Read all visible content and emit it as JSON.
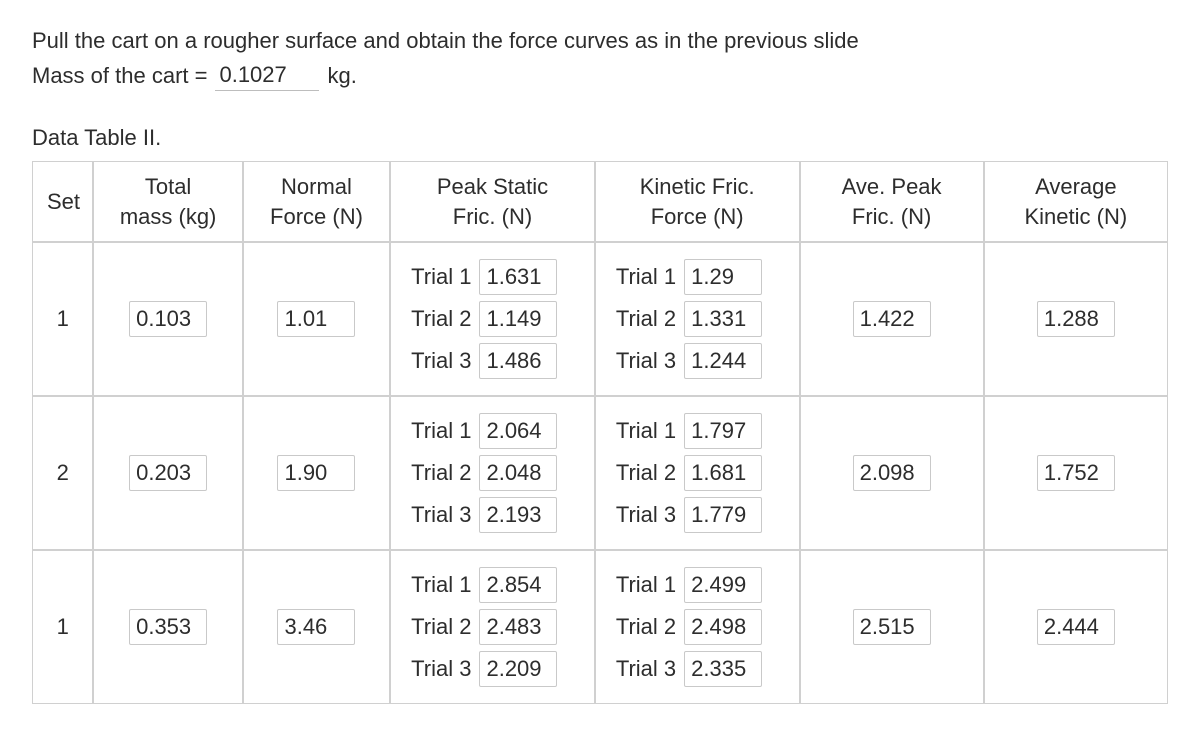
{
  "intro": "Pull the cart on a rougher surface and obtain the force curves as in the previous slide",
  "mass_prefix": "Mass of the cart =",
  "mass_value": "0.1027",
  "mass_unit": "kg.",
  "table_title": "Data Table II.",
  "headers": {
    "set": "Set",
    "total_mass_l1": "Total",
    "total_mass_l2": "mass (kg)",
    "normal_l1": "Normal",
    "normal_l2": "Force (N)",
    "peak_l1": "Peak Static",
    "peak_l2": "Fric. (N)",
    "kinetic_l1": "Kinetic Fric.",
    "kinetic_l2": "Force (N)",
    "ave_peak_l1": "Ave. Peak",
    "ave_peak_l2": "Fric. (N)",
    "ave_kin_l1": "Average",
    "ave_kin_l2": "Kinetic (N)"
  },
  "trial_labels": {
    "t1": "Trial 1",
    "t2": "Trial 2",
    "t3": "Trial 3"
  },
  "rows": [
    {
      "set": "1",
      "total_mass": "0.103",
      "normal_force": "1.01",
      "peak": {
        "t1": "1.631",
        "t2": "1.149",
        "t3": "1.486"
      },
      "kinetic": {
        "t1": "1.29",
        "t2": "1.331",
        "t3": "1.244"
      },
      "ave_peak": "1.422",
      "ave_kinetic": "1.288"
    },
    {
      "set": "2",
      "total_mass": "0.203",
      "normal_force": "1.90",
      "peak": {
        "t1": "2.064",
        "t2": "2.048",
        "t3": "2.193"
      },
      "kinetic": {
        "t1": "1.797",
        "t2": "1.681",
        "t3": "1.779"
      },
      "ave_peak": "2.098",
      "ave_kinetic": "1.752"
    },
    {
      "set": "1",
      "total_mass": "0.353",
      "normal_force": "3.46",
      "peak": {
        "t1": "2.854",
        "t2": "2.483",
        "t3": "2.209"
      },
      "kinetic": {
        "t1": "2.499",
        "t2": "2.498",
        "t3": "2.335"
      },
      "ave_peak": "2.515",
      "ave_kinetic": "2.444"
    }
  ]
}
